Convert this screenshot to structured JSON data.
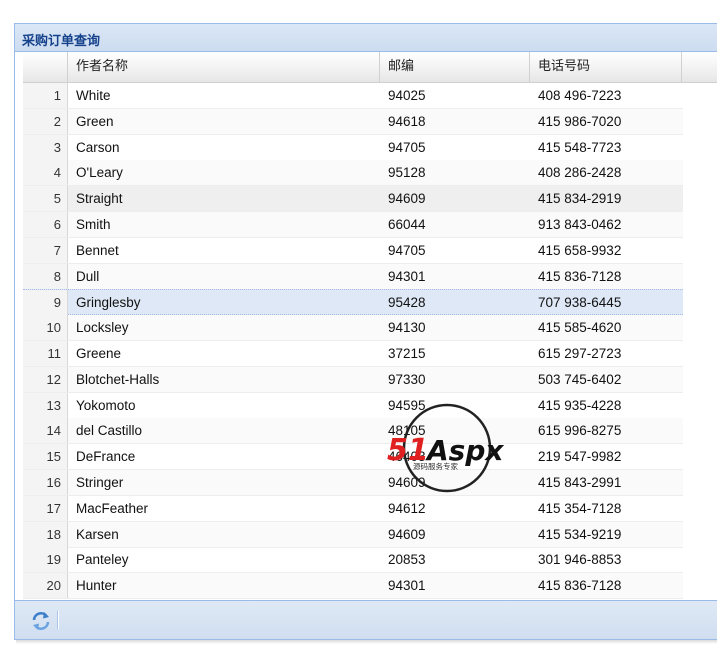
{
  "panel": {
    "title": "采购订单查询"
  },
  "columns": [
    "",
    "作者名称",
    "邮编",
    "电话号码"
  ],
  "rows": [
    {
      "num": "1",
      "name": "White",
      "zip": "94025",
      "phone": "408 496-7223"
    },
    {
      "num": "2",
      "name": "Green",
      "zip": "94618",
      "phone": "415 986-7020"
    },
    {
      "num": "3",
      "name": "Carson",
      "zip": "94705",
      "phone": "415 548-7723"
    },
    {
      "num": "4",
      "name": "O'Leary",
      "zip": "95128",
      "phone": "408 286-2428"
    },
    {
      "num": "5",
      "name": "Straight",
      "zip": "94609",
      "phone": "415 834-2919"
    },
    {
      "num": "6",
      "name": "Smith",
      "zip": "66044",
      "phone": "913 843-0462"
    },
    {
      "num": "7",
      "name": "Bennet",
      "zip": "94705",
      "phone": "415 658-9932"
    },
    {
      "num": "8",
      "name": "Dull",
      "zip": "94301",
      "phone": "415 836-7128"
    },
    {
      "num": "9",
      "name": "Gringlesby",
      "zip": "95428",
      "phone": "707 938-6445"
    },
    {
      "num": "10",
      "name": "Locksley",
      "zip": "94130",
      "phone": "415 585-4620"
    },
    {
      "num": "11",
      "name": "Greene",
      "zip": "37215",
      "phone": "615 297-2723"
    },
    {
      "num": "12",
      "name": "Blotchet-Halls",
      "zip": "97330",
      "phone": "503 745-6402"
    },
    {
      "num": "13",
      "name": "Yokomoto",
      "zip": "94595",
      "phone": "415 935-4228"
    },
    {
      "num": "14",
      "name": "del Castillo",
      "zip": "48105",
      "phone": "615 996-8275"
    },
    {
      "num": "15",
      "name": "DeFrance",
      "zip": "46403",
      "phone": "219 547-9982"
    },
    {
      "num": "16",
      "name": "Stringer",
      "zip": "94609",
      "phone": "415 843-2991"
    },
    {
      "num": "17",
      "name": "MacFeather",
      "zip": "94612",
      "phone": "415 354-7128"
    },
    {
      "num": "18",
      "name": "Karsen",
      "zip": "94609",
      "phone": "415 534-9219"
    },
    {
      "num": "19",
      "name": "Panteley",
      "zip": "20853",
      "phone": "301 946-8853"
    },
    {
      "num": "20",
      "name": "Hunter",
      "zip": "94301",
      "phone": "415 836-7128"
    }
  ],
  "selected_row": 8,
  "hover_row": 4,
  "footer": {
    "refresh_icon": "refresh-icon"
  },
  "watermark": {
    "brand": "51Aspx",
    "tagline": "源码服务专家"
  },
  "colors": {
    "header_text": "#15428b",
    "border": "#99bbe8",
    "selected": "#dfe8f6"
  }
}
